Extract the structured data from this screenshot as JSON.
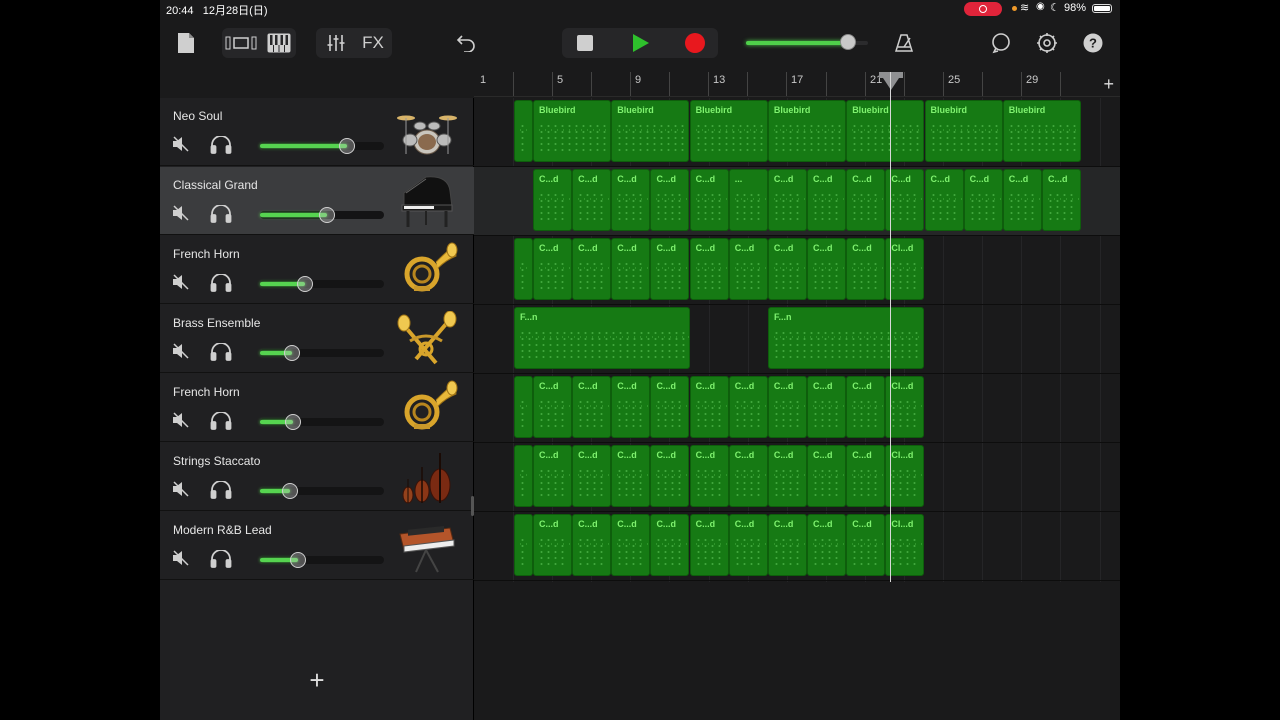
{
  "status": {
    "time": "20:44",
    "date": "12月28日(日)",
    "battery": "98%"
  },
  "toolbar": {
    "fx_label": "FX",
    "master_volume": 0.84,
    "icons": [
      "document-icon",
      "tracks-view-icon",
      "keyboard-icon",
      "mixer-icon",
      "fx-button",
      "undo-icon",
      "stop-icon",
      "play-icon",
      "record-icon",
      "metronome-icon",
      "loop-icon",
      "settings-icon",
      "help-icon"
    ]
  },
  "ruler": {
    "bars": [
      "1",
      "5",
      "9",
      "13",
      "17",
      "21",
      "25",
      "29"
    ],
    "add_label": "+"
  },
  "tracks": [
    {
      "name": "Neo Soul",
      "volume": 0.7,
      "icon": "drum-kit-icon",
      "selected": false
    },
    {
      "name": "Classical Grand",
      "volume": 0.54,
      "icon": "grand-piano-icon",
      "selected": true
    },
    {
      "name": "French Horn",
      "volume": 0.36,
      "icon": "french-horn-icon",
      "selected": false
    },
    {
      "name": "Brass Ensemble",
      "volume": 0.26,
      "icon": "brass-ensemble-icon",
      "selected": false
    },
    {
      "name": "French Horn",
      "volume": 0.27,
      "icon": "french-horn-icon",
      "selected": false
    },
    {
      "name": "Strings Staccato",
      "volume": 0.24,
      "icon": "strings-icon",
      "selected": false
    },
    {
      "name": "Modern R&B Lead",
      "volume": 0.31,
      "icon": "synth-icon",
      "selected": false
    }
  ],
  "regions": [
    {
      "track": 0,
      "labels": [
        "",
        "Bluebird",
        "Bluebird",
        "Bluebird",
        "Bluebird",
        "Bluebird",
        "Bluebird",
        "Bluebird"
      ]
    },
    {
      "track": 1,
      "labels": [
        "C...d",
        "C...d",
        "C...d",
        "C...d",
        "C...d",
        "...",
        "C...d",
        "C...d",
        "C...d",
        "C...d",
        "C...d",
        "C...d",
        "C...d",
        "C...d"
      ]
    },
    {
      "track": 2,
      "labels": [
        "",
        "C...d",
        "C...d",
        "C...d",
        "C...d",
        "C...d",
        "C...d",
        "C...d",
        "C...d",
        "C...d",
        "Cl...d"
      ]
    },
    {
      "track": 3,
      "labels": [
        "F...n",
        "F...n"
      ]
    },
    {
      "track": 4,
      "labels": [
        "",
        "C...d",
        "C...d",
        "C...d",
        "C...d",
        "C...d",
        "C...d",
        "C...d",
        "C...d",
        "C...d",
        "Cl...d"
      ]
    },
    {
      "track": 5,
      "labels": [
        "",
        "C...d",
        "C...d",
        "C...d",
        "C...d",
        "C...d",
        "C...d",
        "C...d",
        "C...d",
        "C...d",
        "Cl...d"
      ]
    },
    {
      "track": 6,
      "labels": [
        "",
        "C...d",
        "C...d",
        "C...d",
        "C...d",
        "C...d",
        "C...d",
        "C...d",
        "C...d",
        "C...d",
        "Cl...d"
      ]
    }
  ],
  "add_track_label": "+"
}
